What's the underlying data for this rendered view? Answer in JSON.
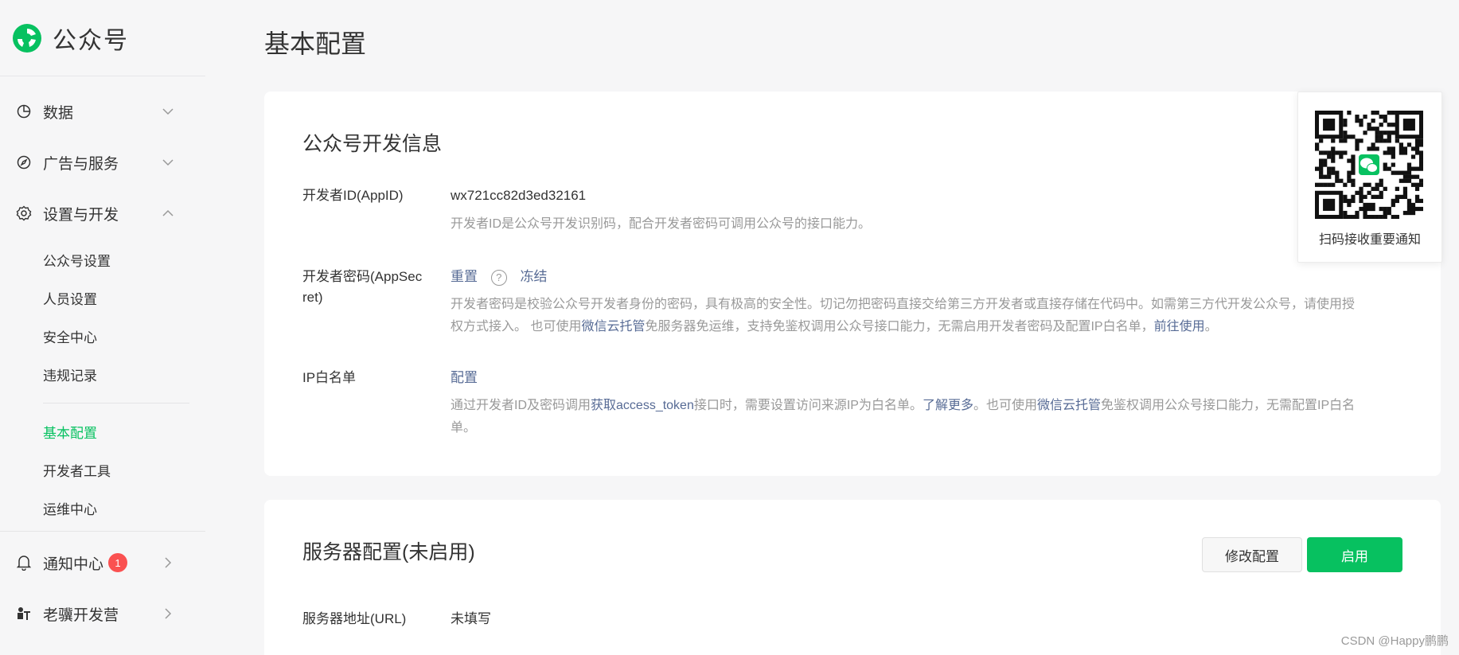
{
  "brand": {
    "name": "公众号"
  },
  "sidebar": {
    "data": "数据",
    "ads": "广告与服务",
    "settings": "设置与开发",
    "sub_items": [
      "公众号设置",
      "人员设置",
      "安全中心",
      "违规记录"
    ],
    "dev_items": [
      "基本配置",
      "开发者工具",
      "运维中心"
    ],
    "notify": "通知中心",
    "notify_badge": "1",
    "camp": "老骥开发营"
  },
  "page": {
    "title": "基本配置"
  },
  "dev_info": {
    "title": "公众号开发信息",
    "appid": {
      "label": "开发者ID(AppID)",
      "value": "wx721cc82d3ed32161",
      "desc": "开发者ID是公众号开发识别码，配合开发者密码可调用公众号的接口能力。"
    },
    "secret": {
      "label_1": "开发者密码(AppSec",
      "label_2": "ret)",
      "reset": "重置",
      "help": "?",
      "freeze": "冻结",
      "desc_1": "开发者密码是校验公众号开发者身份的密码，具有极高的安全性。切记勿把密码直接交给第三方开发者或直接存储在代码中。如需第三方代开发公众号，请使用授",
      "desc_2a": "权方式接入。 也可使用",
      "desc_2_link": "微信云托管",
      "desc_2b": "免服务器免运维，支持免鉴权调用公众号接口能力，无需启用开发者密码及配置IP白名单，",
      "desc_2_link2": "前往使用",
      "desc_2c": "。"
    },
    "ip": {
      "label": "IP白名单",
      "config": "配置",
      "desc_1a": "通过开发者ID及密码调用",
      "desc_1_link": "获取access_token",
      "desc_1b": "接口时，需要设置访问来源IP为白名单。",
      "desc_1_link2": "了解更多",
      "desc_1c": "。也可使用",
      "desc_1_link3": "微信云托管",
      "desc_1d": "免鉴权调用公众号接口能力，无需配置IP白名",
      "desc_2": "单。"
    }
  },
  "server": {
    "title": "服务器配置(未启用)",
    "modify": "修改配置",
    "enable": "启用",
    "url_label": "服务器地址(URL)",
    "url_value": "未填写"
  },
  "qr": {
    "text": "扫码接收重要通知"
  },
  "watermark": "CSDN @Happy鹏鹏",
  "colors": {
    "accent": "#07c160",
    "link": "#576b95",
    "badge": "#fa5151"
  }
}
